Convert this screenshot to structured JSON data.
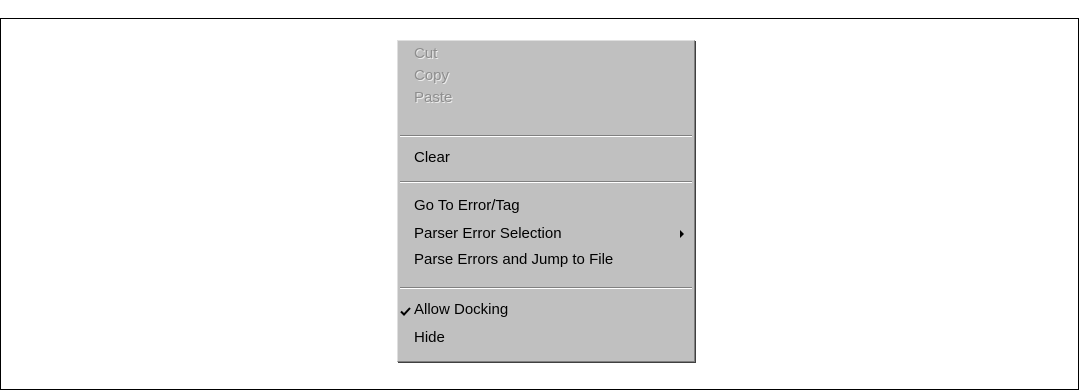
{
  "menu": {
    "items": [
      {
        "label": "Cut",
        "enabled": false
      },
      {
        "label": "Copy",
        "enabled": false
      },
      {
        "label": "Paste",
        "enabled": false
      },
      {
        "label": "Clear",
        "enabled": true
      },
      {
        "label": "Go To Error/Tag",
        "enabled": true
      },
      {
        "label": "Parser Error Selection",
        "enabled": true,
        "submenu": true
      },
      {
        "label": "Parse Errors and Jump to File",
        "enabled": true
      },
      {
        "label": "Allow Docking",
        "enabled": true,
        "checked": true
      },
      {
        "label": "Hide",
        "enabled": true
      }
    ]
  },
  "colors": {
    "menu_background": "#c0c0c0",
    "disabled_text": "#8e8e8e",
    "text": "#000000"
  }
}
